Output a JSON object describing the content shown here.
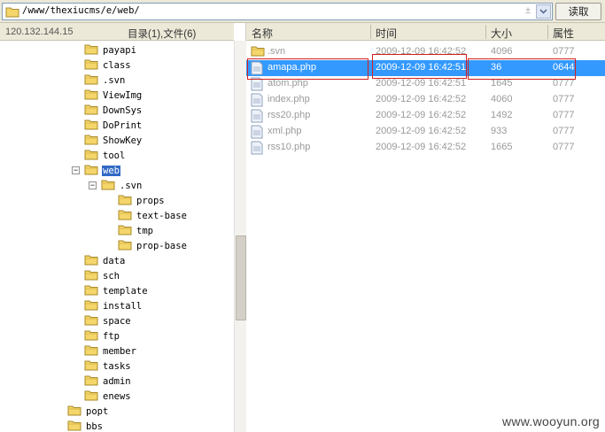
{
  "path_bar": {
    "path": "/www/thexiucms/e/web/",
    "dropdown_marker": "±",
    "read_label": "读取"
  },
  "left_panel": {
    "ip": "120.132.144.15",
    "summary": "目录(1),文件(6)",
    "tree": [
      {
        "label": "payapi"
      },
      {
        "label": "class"
      },
      {
        "label": ".svn"
      },
      {
        "label": "ViewImg"
      },
      {
        "label": "DownSys"
      },
      {
        "label": "DoPrint"
      },
      {
        "label": "ShowKey"
      },
      {
        "label": "tool"
      },
      {
        "label": "web",
        "toggle": "−",
        "selected": true
      },
      {
        "label": ".svn",
        "toggle": "−"
      },
      {
        "label": "props"
      },
      {
        "label": "text-base"
      },
      {
        "label": "tmp"
      },
      {
        "label": "prop-base"
      },
      {
        "label": "data"
      },
      {
        "label": "sch"
      },
      {
        "label": "template"
      },
      {
        "label": "install"
      },
      {
        "label": "space"
      },
      {
        "label": "ftp"
      },
      {
        "label": "member"
      },
      {
        "label": "tasks"
      },
      {
        "label": "admin"
      },
      {
        "label": "enews"
      },
      {
        "label": "popt"
      },
      {
        "label": "bbs"
      }
    ]
  },
  "file_list": {
    "columns": [
      "名称",
      "时间",
      "大小",
      "属性"
    ],
    "rows": [
      {
        "name": ".svn",
        "time": "2009-12-09 16:42:52",
        "size": "4096",
        "attr": "0777",
        "type": "folder"
      },
      {
        "name": "amapa.php",
        "time": "2009-12-09 16:42:51",
        "size": "36",
        "attr": "0644",
        "type": "file",
        "selected": true
      },
      {
        "name": "atom.php",
        "time": "2009-12-09 16:42:51",
        "size": "1645",
        "attr": "0777",
        "type": "file"
      },
      {
        "name": "index.php",
        "time": "2009-12-09 16:42:52",
        "size": "4060",
        "attr": "0777",
        "type": "file"
      },
      {
        "name": "rss20.php",
        "time": "2009-12-09 16:42:52",
        "size": "1492",
        "attr": "0777",
        "type": "file"
      },
      {
        "name": "xml.php",
        "time": "2009-12-09 16:42:52",
        "size": "933",
        "attr": "0777",
        "type": "file"
      },
      {
        "name": "rss10.php",
        "time": "2009-12-09 16:42:52",
        "size": "1665",
        "attr": "0777",
        "type": "file"
      }
    ]
  },
  "watermark": "www.wooyun.org",
  "colors": {
    "selection": "#3399ff",
    "tree_selection": "#316ac5",
    "annotation": "#d32020",
    "folder": "#f5d66b"
  }
}
